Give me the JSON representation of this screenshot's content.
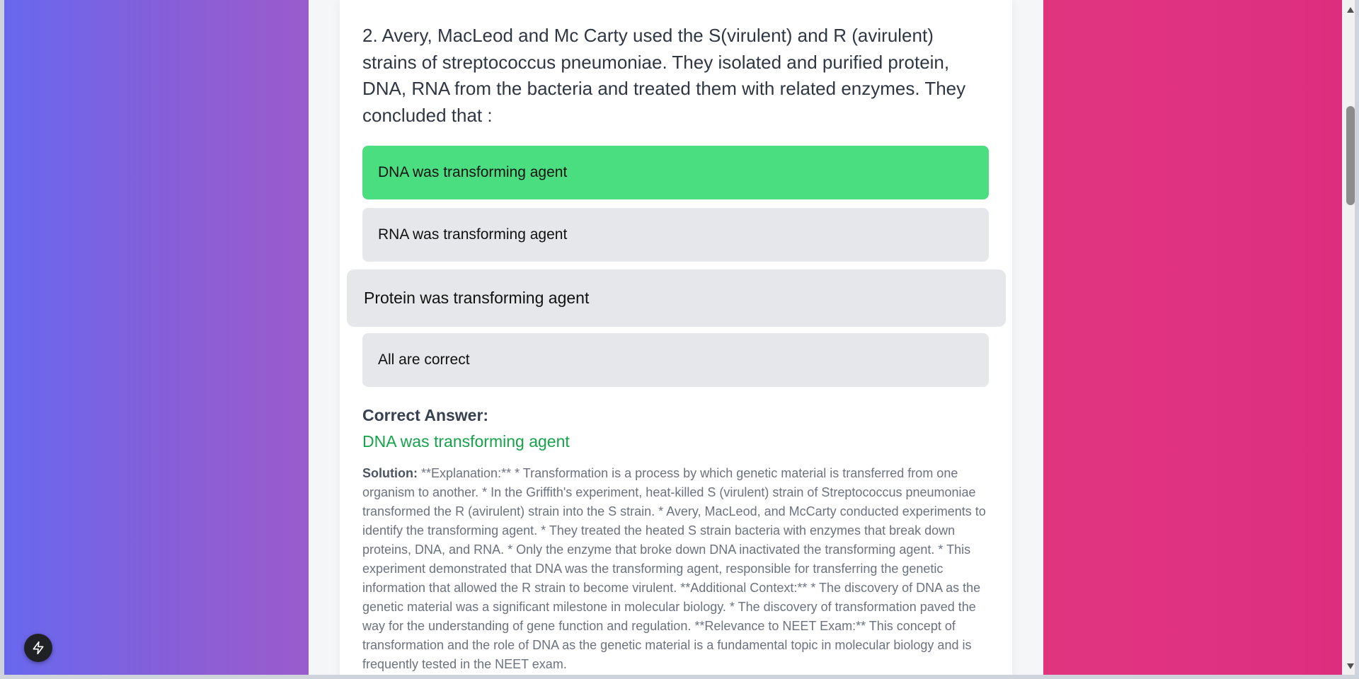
{
  "colors": {
    "left_gradient_start": "#6868ee",
    "left_gradient_end": "#9a5ccc",
    "right_background": "#df3182",
    "correct_option_bg": "#4ade80",
    "option_bg": "#e5e7eb",
    "correct_answer_text": "#16a34a"
  },
  "question": {
    "text": "2. Avery, MacLeod and Mc Carty used the S(virulent) and R (avirulent) strains of streptococcus pneumoniae. They isolated and purified protein, DNA, RNA from the bacteria and treated them with related enzymes. They concluded that :"
  },
  "options": [
    {
      "label": "DNA was transforming agent",
      "state": "correct"
    },
    {
      "label": "RNA was transforming agent",
      "state": "default"
    },
    {
      "label": "Protein was transforming agent",
      "state": "hover"
    },
    {
      "label": "All are correct",
      "state": "default"
    }
  ],
  "correct_answer": {
    "heading": "Correct Answer:",
    "value": "DNA was transforming agent"
  },
  "solution": {
    "label": "Solution:",
    "text": " **Explanation:** * Transformation is a process by which genetic material is transferred from one organism to another. * In the Griffith's experiment, heat-killed S (virulent) strain of Streptococcus pneumoniae transformed the R (avirulent) strain into the S strain. * Avery, MacLeod, and McCarty conducted experiments to identify the transforming agent. * They treated the heated S strain bacteria with enzymes that break down proteins, DNA, and RNA. * Only the enzyme that broke down DNA inactivated the transforming agent. * This experiment demonstrated that DNA was the transforming agent, responsible for transferring the genetic information that allowed the R strain to become virulent. **Additional Context:** * The discovery of DNA as the genetic material was a significant milestone in molecular biology. * The discovery of transformation paved the way for the understanding of gene function and regulation. **Relevance to NEET Exam:** This concept of transformation and the role of DNA as the genetic material is a fundamental topic in molecular biology and is frequently tested in the NEET exam."
  },
  "icons": {
    "fab": "lightning-bolt-icon",
    "scroll_up": "triangle-up-icon",
    "scroll_down": "triangle-down-icon"
  },
  "scroll": {
    "position_fraction": 0.16
  }
}
